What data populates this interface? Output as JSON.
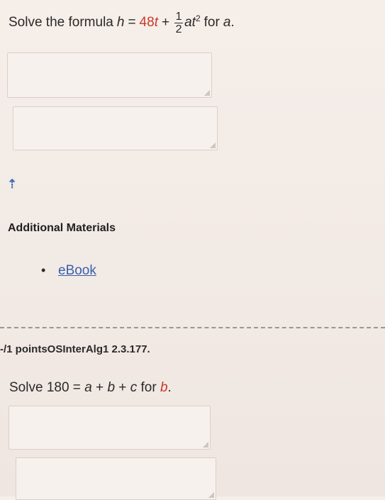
{
  "question1": {
    "prefix": "Solve the formula",
    "lhs_var": "h",
    "equals": "=",
    "term1_coeff": "48",
    "term1_var": "t",
    "plus": "+",
    "frac_num": "1",
    "frac_den": "2",
    "term2_var1": "a",
    "term2_var2": "t",
    "exponent": "2",
    "for_text": "for",
    "target_var": "a",
    "period": "."
  },
  "upload_icon": "upload-icon",
  "additional": {
    "heading": "Additional Materials",
    "bullet": "•",
    "ebook": "eBook"
  },
  "question2": {
    "points": "-/1 pointsOSInterAlg1 2.3.177.",
    "prefix": "Solve",
    "number": "180",
    "equals": "=",
    "a": "a",
    "plus1": "+",
    "b": "b",
    "plus2": "+",
    "c": "c",
    "for_text": "for",
    "target_var": "b",
    "period": "."
  },
  "colors": {
    "background": "#f3ebe6",
    "link": "#3b5fae",
    "highlight_red": "#c83a2a"
  }
}
